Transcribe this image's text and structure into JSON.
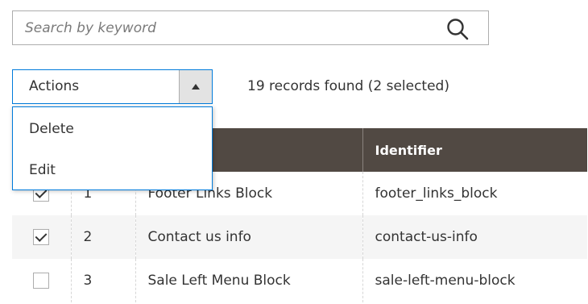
{
  "search": {
    "placeholder": "Search by keyword",
    "value": "",
    "icon": "search-icon"
  },
  "actions": {
    "label": "Actions",
    "toggle_icon": "triangle-up-icon",
    "menu": [
      "Delete",
      "Edit"
    ]
  },
  "records": {
    "summary": "19 records found (2 selected)"
  },
  "grid": {
    "columns": [
      "",
      "",
      "",
      "Identifier"
    ],
    "rows": [
      {
        "checked": true,
        "id": "1",
        "title": "Footer Links Block",
        "identifier": "footer_links_block"
      },
      {
        "checked": true,
        "id": "2",
        "title": "Contact us info",
        "identifier": "contact-us-info"
      },
      {
        "checked": false,
        "id": "3",
        "title": "Sale Left Menu Block",
        "identifier": "sale-left-menu-block"
      }
    ]
  },
  "colors": {
    "header_bg": "#514943",
    "focus_border": "#007bdb",
    "stripe": "#f5f5f5"
  }
}
